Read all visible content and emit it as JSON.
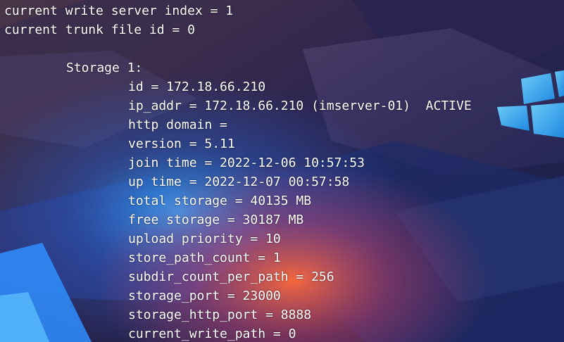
{
  "terminal": {
    "header_lines": [
      "current write server index = 1",
      "current trunk file id = 0"
    ],
    "section_title": "Storage 1:",
    "fields": [
      "id = 172.18.66.210",
      "ip_addr = 172.18.66.210 (imserver-01)  ACTIVE",
      "http domain =",
      "version = 5.11",
      "join time = 2022-12-06 10:57:53",
      "up time = 2022-12-07 00:57:58",
      "total storage = 40135 MB",
      "free storage = 30187 MB",
      "upload priority = 10",
      "store_path_count = 1",
      "subdir_count_per_path = 256",
      "storage_port = 23000",
      "storage_http_port = 8888",
      "current_write_path = 0"
    ]
  },
  "colors": {
    "text": "#ffffff",
    "accent_blue": "#2aa8ff",
    "accent_orange": "#ff7a3d"
  }
}
